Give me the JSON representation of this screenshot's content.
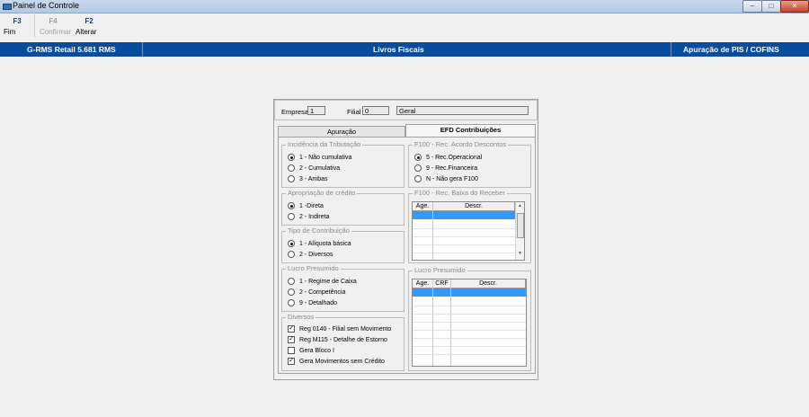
{
  "window": {
    "title": "Painel de Controle",
    "min_label": "–",
    "max_label": "□",
    "close_label": "✕"
  },
  "toolbar": [
    {
      "key": "F3",
      "label": "Fim",
      "enabled": true
    },
    {
      "key": "F4",
      "label": "Confirmar",
      "enabled": false
    },
    {
      "key": "F2",
      "label": "Alterar",
      "enabled": true
    }
  ],
  "header": {
    "app": "G-RMS Retail 5.681 RMS",
    "module": "Livros Fiscais",
    "screen": "Apuração de PIS / COFINS",
    "color": "#0a4c9c"
  },
  "empresa": {
    "empresa_label": "Empresa",
    "empresa_value": "1",
    "filial_label": "Filial",
    "filial_value": "0",
    "filial_desc": "Geral"
  },
  "tabs": [
    {
      "label": "Apuração",
      "active": false
    },
    {
      "label": "EFD Contribuições",
      "active": true
    }
  ],
  "incidencia": {
    "legend": "Incidência da Tributação",
    "options": [
      {
        "label": "1 - Não cumulativa",
        "selected": true
      },
      {
        "label": "2 - Cumulativa",
        "selected": false
      },
      {
        "label": "3 - Ambas",
        "selected": false
      }
    ]
  },
  "apropriacao": {
    "legend": "Apropriação de crédito",
    "options": [
      {
        "label": "1 -Direta",
        "selected": true
      },
      {
        "label": "2 - Indireta",
        "selected": false
      }
    ]
  },
  "tipo_contribuicao": {
    "legend": "Tipo de Contribuição",
    "options": [
      {
        "label": "1 - Alíquota básica",
        "selected": true
      },
      {
        "label": "2 - Diversos",
        "selected": false
      }
    ]
  },
  "lucro_presumido_left": {
    "legend": "Lucro Presumido",
    "options": [
      {
        "label": "1 - Regime de Caixa",
        "selected": false
      },
      {
        "label": "2 - Competência",
        "selected": false
      },
      {
        "label": "9 - Detalhado",
        "selected": false
      }
    ]
  },
  "diversos": {
    "legend": "Diversos",
    "checks": [
      {
        "label": "Reg 0140 - Filial sem Movimento",
        "checked": true
      },
      {
        "label": "Reg M115 - Detalhe de Estorno",
        "checked": true
      },
      {
        "label": "Gera Bloco I",
        "checked": false
      },
      {
        "label": "Gera Movimentos sem Crédito",
        "checked": true
      }
    ]
  },
  "f100_acordo": {
    "legend": "F100 - Rec. Acordo Descontos",
    "options": [
      {
        "label": "5 - Rec.Operacional",
        "selected": true
      },
      {
        "label": "9 - Rec.Financeira",
        "selected": false
      },
      {
        "label": "N - Não gera F100",
        "selected": false
      }
    ]
  },
  "f100_baixa": {
    "legend": "F100 - Rec. Baixa do Receber",
    "columns": [
      "Age.",
      "Descr."
    ]
  },
  "lucro_presumido_right": {
    "legend": "Lucro Presumido",
    "columns": [
      "Age.",
      "CRF",
      "Descr."
    ]
  },
  "colors": {
    "selection": "#3399ff",
    "window_bg": "#f0f0f0"
  }
}
